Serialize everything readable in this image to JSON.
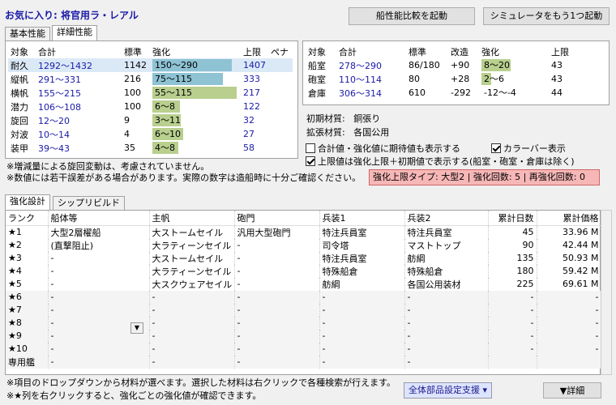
{
  "title": "お気に入り: 将官用ラ・レアル",
  "buttons": {
    "compare": "船性能比較を起動",
    "simulator": "シミュレータをもう1つ起動"
  },
  "tabs_top": [
    "基本性能",
    "詳細性能"
  ],
  "perf": {
    "headers": [
      "対象",
      "合計",
      "標準",
      "強化",
      "上限",
      "ペナ"
    ],
    "rows": [
      {
        "name": "耐久",
        "total": "1292〜1432",
        "std": "1142",
        "enh": "150〜290",
        "limit": "1407",
        "pena": "",
        "fill": 0.92,
        "color": "#8ec3d4"
      },
      {
        "name": "縦帆",
        "total": "291〜331",
        "std": "216",
        "enh": "75〜115",
        "limit": "333",
        "pena": "",
        "fill": 0.82,
        "color": "#8ec3d4"
      },
      {
        "name": "横帆",
        "total": "155〜215",
        "std": "100",
        "enh": "55〜115",
        "limit": "217",
        "pena": "",
        "fill": 0.98,
        "color": "#b8cf8e"
      },
      {
        "name": "潜力",
        "total": "106〜108",
        "std": "100",
        "enh": "6〜8",
        "limit": "122",
        "pena": "",
        "fill": 0.32,
        "color": "#b8cf8e"
      },
      {
        "name": "旋回",
        "total": "12〜20",
        "std": "9",
        "enh": "3〜11",
        "limit": "32",
        "pena": "",
        "fill": 0.33,
        "color": "#b8cf8e"
      },
      {
        "name": "対波",
        "total": "10〜14",
        "std": "4",
        "enh": "6〜10",
        "limit": "27",
        "pena": "",
        "fill": 0.36,
        "color": "#b8cf8e"
      },
      {
        "name": "装甲",
        "total": "39〜43",
        "std": "35",
        "enh": "4〜8",
        "limit": "58",
        "pena": "",
        "fill": 0.3,
        "color": "#b8cf8e"
      }
    ]
  },
  "room": {
    "headers": [
      "対象",
      "合計",
      "標準",
      "改造",
      "強化",
      "上限"
    ],
    "rows": [
      {
        "name": "船室",
        "total": "278〜290",
        "std": "86/180",
        "mod": "+90",
        "enh": "8〜20",
        "limit": "43",
        "fill": 0.45,
        "color": "#b8cf8e"
      },
      {
        "name": "砲室",
        "total": "110〜114",
        "std": "80",
        "mod": "+28",
        "enh": "2〜6",
        "limit": "43",
        "fill": 0.15,
        "color": "#b8cf8e"
      },
      {
        "name": "倉庫",
        "total": "306〜314",
        "std": "610",
        "mod": "-292",
        "enh": "-12〜-4",
        "limit": "44",
        "fill": 0,
        "color": "#b8cf8e"
      }
    ]
  },
  "material": {
    "initial_label": "初期材質:",
    "initial": "銅張り",
    "ext_label": "拡張材質:",
    "ext": "各国公用"
  },
  "options": {
    "expect": "合計値・強化値に期待値も表示する",
    "colorbar": "カラーバー表示",
    "limit": "上限値は強化上限＋初期値で表示する(船室・砲室・倉庫は除く)",
    "expect_checked": false,
    "colorbar_checked": true,
    "limit_checked": true
  },
  "notes": [
    "※増減量による旋回変動は、考慮されていません。",
    "※数値には若干誤差がある場合があります。実際の数字は造船時に十分ご確認ください。"
  ],
  "limit_type": "強化上限タイプ: 大型2 | 強化回数: 5 | 再強化回数: 0",
  "tabs_bottom": [
    "強化設計",
    "シップリビルド"
  ],
  "grid": {
    "headers": [
      "ランク",
      "船体等",
      "主帆",
      "砲門",
      "兵装1",
      "兵装2",
      "累計日数",
      "累計価格"
    ],
    "rows": [
      [
        "★1",
        "大型2層櫂船",
        "大ストームセイル",
        "汎用大型砲門",
        "特注兵員室",
        "特注兵員室",
        "45",
        "33.96 M"
      ],
      [
        "★2",
        "(直撃阻止)",
        "大ラティーンセイル",
        "-",
        "司令塔",
        "マストトップ",
        "90",
        "42.44 M"
      ],
      [
        "★3",
        "-",
        "大ストームセイル",
        "-",
        "特注兵員室",
        "舫綱",
        "135",
        "50.93 M"
      ],
      [
        "★4",
        "-",
        "大ラティーンセイル",
        "-",
        "特殊船倉",
        "特殊船倉",
        "180",
        "59.42 M"
      ],
      [
        "★5",
        "-",
        "大スクウェアセイル",
        "-",
        "舫綱",
        "各国公用装材",
        "225",
        "69.61 M"
      ],
      [
        "★6",
        "-",
        "-",
        "-",
        "-",
        "-",
        "-",
        "-"
      ],
      [
        "★7",
        "-",
        "-",
        "-",
        "-",
        "-",
        "-",
        "-"
      ],
      [
        "★8",
        "-",
        "-",
        "-",
        "-",
        "-",
        "-",
        "-"
      ],
      [
        "★9",
        "-",
        "-",
        "-",
        "-",
        "-",
        "-",
        "-"
      ],
      [
        "★10",
        "-",
        "-",
        "-",
        "-",
        "-",
        "-",
        "-"
      ],
      [
        "専用艦",
        "-",
        "-",
        "-",
        "-",
        "-",
        "",
        ""
      ]
    ]
  },
  "bottom_notes": [
    "※項目のドロップダウンから材料が選べます。選択した材料は右クリックで各種検索が行えます。",
    "※★列を右クリックすると、強化ごとの強化値が確認できます。"
  ],
  "support_select": "全体部品設定支援",
  "detail_button": "▼詳細"
}
